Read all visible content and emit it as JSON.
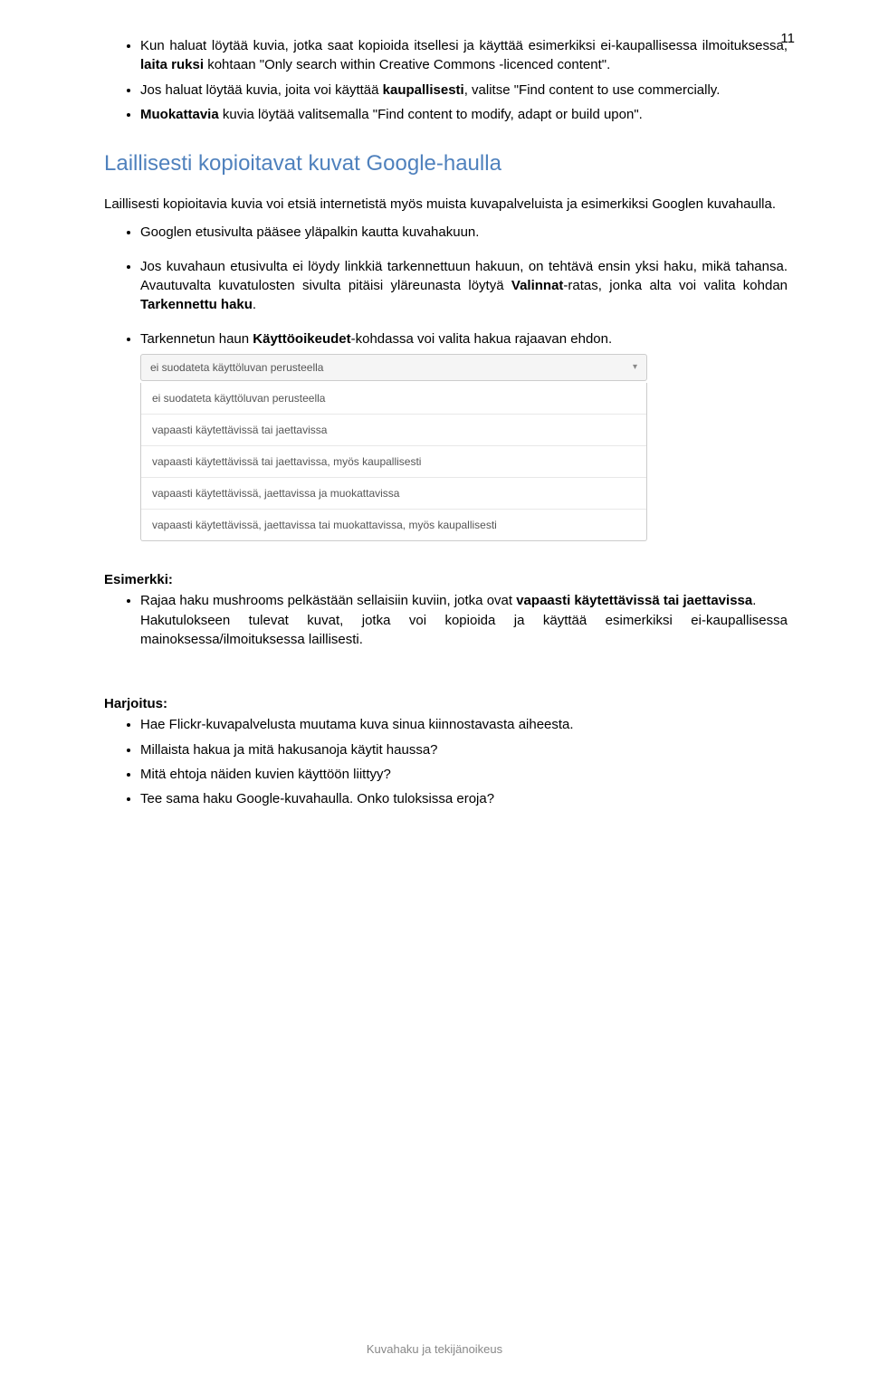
{
  "page_number": "11",
  "bullets_top": {
    "b1_pre": "Kun haluat löytää kuvia, jotka saat kopioida itsellesi ja käyttää esimerkiksi ei-kaupallisessa ilmoituksessa, ",
    "b1_bold": "laita ruksi",
    "b1_post": " kohtaan \"Only search within Creative Commons -licenced content\".",
    "b2_pre": "Jos haluat löytää kuvia, joita voi käyttää ",
    "b2_bold": "kaupallisesti",
    "b2_post": ", valitse \"Find content to use commercially.",
    "b3_pre": "",
    "b3_bold": "Muokattavia",
    "b3_post": " kuvia löytää valitsemalla \"Find content to modify, adapt or build upon\"."
  },
  "heading": "Laillisesti kopioitavat kuvat Google-haulla",
  "lead": "Laillisesti kopioitavia kuvia voi etsiä internetistä myös muista kuvapalveluista ja esimerkiksi Googlen kuvahaulla.",
  "bullets_mid": {
    "m1": "Googlen etusivulta pääsee yläpalkin kautta kuvahakuun.",
    "m2_pre": "Jos kuvahaun etusivulta ei löydy linkkiä tarkennettuun hakuun, on tehtävä ensin yksi haku, mikä tahansa. Avautuvalta kuvatulosten sivulta pitäisi yläreunasta löytyä ",
    "m2_bold1": "Valinnat",
    "m2_mid": "-ratas, jonka alta voi valita kohdan ",
    "m2_bold2": "Tarkennettu haku",
    "m2_post": ".",
    "m3_pre": "Tarkennetun haun ",
    "m3_bold": "Käyttöoikeudet",
    "m3_post": "-kohdassa voi valita hakua rajaavan ehdon."
  },
  "dropdown": {
    "selected": "ei suodateta käyttöluvan perusteella",
    "items": [
      "ei suodateta käyttöluvan perusteella",
      "vapaasti käytettävissä tai jaettavissa",
      "vapaasti käytettävissä tai jaettavissa, myös kaupallisesti",
      "vapaasti käytettävissä, jaettavissa ja muokattavissa",
      "vapaasti käytettävissä, jaettavissa tai muokattavissa, myös kaupallisesti"
    ]
  },
  "esimerkki": {
    "title": "Esimerkki:",
    "e1_pre": "Rajaa haku mushrooms pelkästään sellaisiin kuviin, jotka ovat ",
    "e1_bold": "vapaasti käytettävissä tai jaettavissa",
    "e1_post": ".",
    "e1_line2": "Hakutulokseen tulevat kuvat, jotka voi kopioida ja käyttää esimerkiksi ei-kaupallisessa mainoksessa/ilmoituksessa laillisesti."
  },
  "harjoitus": {
    "title": "Harjoitus:",
    "h1": "Hae Flickr-kuvapalvelusta muutama kuva sinua kiinnostavasta aiheesta.",
    "h2": "Millaista hakua ja mitä hakusanoja käytit haussa?",
    "h3": "Mitä ehtoja näiden kuvien käyttöön liittyy?",
    "h4": "Tee sama haku Google-kuvahaulla. Onko tuloksissa eroja?"
  },
  "footer": "Kuvahaku ja tekijänoikeus"
}
